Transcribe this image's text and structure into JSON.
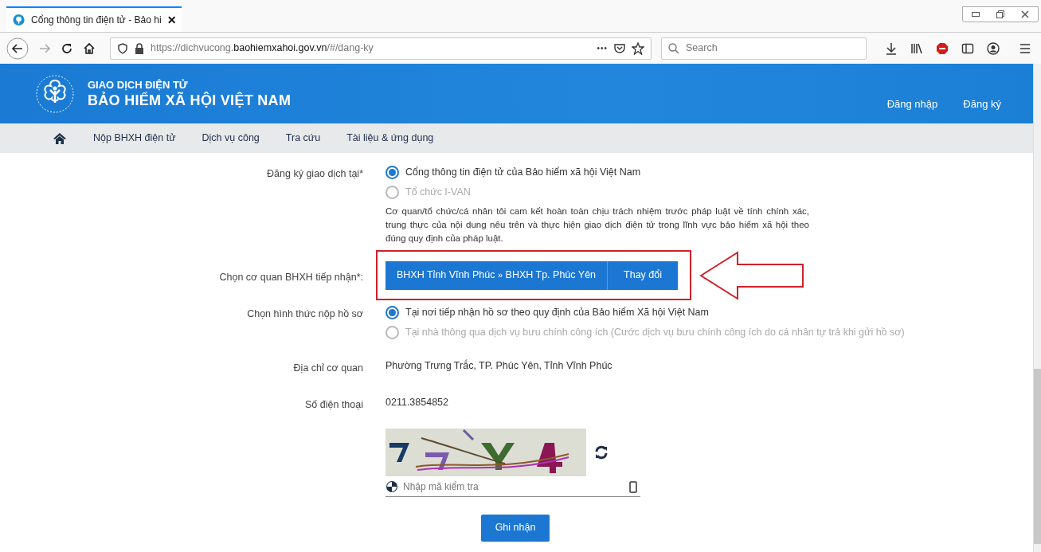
{
  "browser": {
    "tab": {
      "title": "Cổng thông tin điện tử - Bảo hi",
      "selected": true
    },
    "url": {
      "prefix": "https://dichvucong.",
      "domain": "baohiemxahoi.gov.vn",
      "suffix": "/#/dang-ky"
    },
    "search": {
      "placeholder": "Search"
    },
    "more": "•••"
  },
  "header": {
    "subtitle": "GIAO DỊCH ĐIỆN TỬ",
    "title": "BẢO HIỂM XÃ HỘI VIỆT NAM",
    "links": [
      "Đăng nhập",
      "Đăng ký"
    ]
  },
  "nav": {
    "items": [
      "Nộp BHXH điện tử",
      "Dịch vụ công",
      "Tra cứu",
      "Tài liệu & ứng dụng"
    ]
  },
  "form": {
    "register_at": {
      "label": "Đăng ký giao dịch tại*",
      "options": [
        {
          "label": "Cổng thông tin điện tử của Bảo hiểm xã hội Việt Nam",
          "selected": true
        },
        {
          "label": "Tổ chức I-VAN",
          "selected": false
        }
      ],
      "note": "Cơ quan/tổ chức/cá nhân tôi cam kết hoàn toàn chịu trách nhiệm trước pháp luật về tính chính xác, trung thực của nội dung nêu trên và thực hiện giao dịch điện tử trong lĩnh vực bảo hiểm xã hội theo đúng quy định của pháp luật."
    },
    "agency": {
      "label": "Chọn cơ quan BHXH tiếp nhận*:",
      "from": "BHXH Tỉnh Vĩnh Phúc",
      "separator": "»",
      "to": "BHXH Tp. Phúc Yên",
      "change_button": "Thay đổi",
      "highlighted": true
    },
    "submission": {
      "label": "Chọn hình thức nộp hồ sơ",
      "options": [
        {
          "label": "Tại nơi tiếp nhận hồ sơ theo quy định của Bảo hiểm Xã hội Việt Nam",
          "selected": true
        },
        {
          "label": "Tại nhà thông qua dịch vụ bưu chính công ích (Cước dịch vụ bưu chính công ích do cá nhân tự trả khi gửi hồ sơ)",
          "selected": false
        }
      ]
    },
    "address": {
      "label": "Địa chỉ cơ quan",
      "value": "Phường Trưng Trắc, TP. Phúc Yên, Tỉnh Vĩnh Phúc"
    },
    "phone": {
      "label": "Số điện thoại",
      "value": "0211.3854852"
    },
    "captcha": {
      "placeholder": "Nhập mã kiểm tra"
    },
    "submit": "Ghi nhận"
  }
}
